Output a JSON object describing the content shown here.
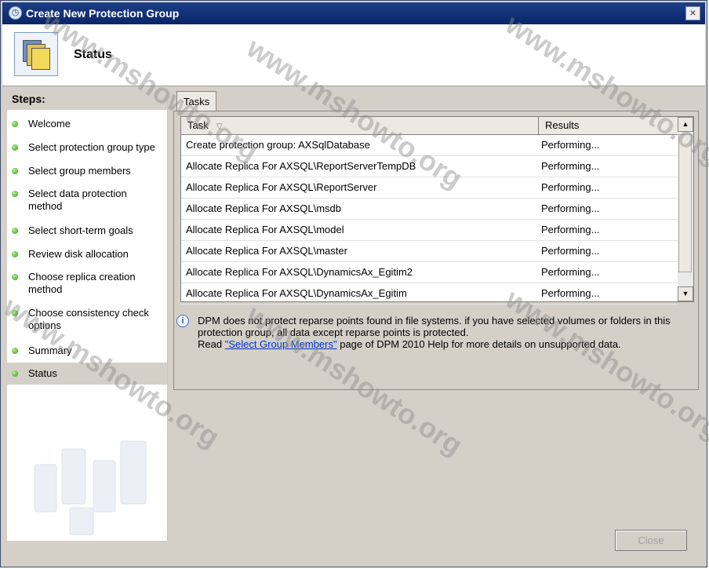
{
  "window": {
    "title": "Create New Protection Group",
    "close_symbol": "×"
  },
  "header": {
    "title": "Status"
  },
  "sidebar": {
    "title": "Steps:",
    "items": [
      {
        "label": "Welcome"
      },
      {
        "label": "Select protection group type"
      },
      {
        "label": "Select group members"
      },
      {
        "label": "Select data protection method"
      },
      {
        "label": "Select short-term goals"
      },
      {
        "label": "Review disk allocation"
      },
      {
        "label": "Choose replica creation method"
      },
      {
        "label": "Choose consistency check options"
      },
      {
        "label": "Summary"
      },
      {
        "label": "Status"
      }
    ]
  },
  "tabs": [
    {
      "label": "Tasks"
    }
  ],
  "table": {
    "columns": {
      "task": "Task",
      "results": "Results"
    },
    "rows": [
      {
        "task": "Create protection group: AXSqlDatabase",
        "result": "Performing..."
      },
      {
        "task": "Allocate Replica For AXSQL\\ReportServerTempDB",
        "result": "Performing..."
      },
      {
        "task": "Allocate Replica For AXSQL\\ReportServer",
        "result": "Performing..."
      },
      {
        "task": "Allocate Replica For AXSQL\\msdb",
        "result": "Performing..."
      },
      {
        "task": "Allocate Replica For AXSQL\\model",
        "result": "Performing..."
      },
      {
        "task": "Allocate Replica For AXSQL\\master",
        "result": "Performing..."
      },
      {
        "task": "Allocate Replica For AXSQL\\DynamicsAx_Egitim2",
        "result": "Performing..."
      },
      {
        "task": "Allocate Replica For AXSQL\\DynamicsAx_Egitim",
        "result": "Performing..."
      }
    ]
  },
  "info": {
    "line1": "DPM does not protect reparse points found in file systems. if you have selected volumes or folders in this protection group, all data except reparse points is protected.",
    "line2_prefix": "Read ",
    "link": "\"Select Group Members\"",
    "line2_suffix": " page of DPM 2010 Help for more details on unsupported data."
  },
  "buttons": {
    "close": "Close"
  },
  "watermark": "www.mshowto.org"
}
